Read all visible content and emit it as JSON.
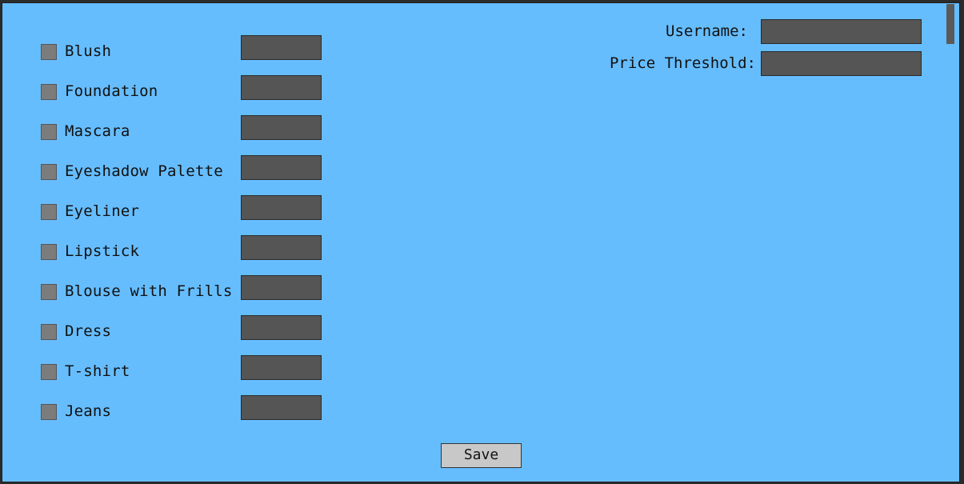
{
  "colors": {
    "background": "#66bdfe",
    "input_fill": "#555555",
    "checkbox_fill": "#7c7c7c",
    "button_fill": "#c8c8c8"
  },
  "items": [
    {
      "label": "Blush",
      "checked": false,
      "value": ""
    },
    {
      "label": "Foundation",
      "checked": false,
      "value": ""
    },
    {
      "label": "Mascara",
      "checked": false,
      "value": ""
    },
    {
      "label": "Eyeshadow Palette",
      "checked": false,
      "value": ""
    },
    {
      "label": "Eyeliner",
      "checked": false,
      "value": ""
    },
    {
      "label": "Lipstick",
      "checked": false,
      "value": ""
    },
    {
      "label": "Blouse with Frills",
      "checked": false,
      "value": ""
    },
    {
      "label": "Dress",
      "checked": false,
      "value": ""
    },
    {
      "label": "T-shirt",
      "checked": false,
      "value": ""
    },
    {
      "label": "Jeans",
      "checked": false,
      "value": ""
    }
  ],
  "settings": {
    "username_label": "Username:",
    "username_value": "",
    "price_threshold_label": "Price Threshold:",
    "price_threshold_value": ""
  },
  "save_label": "Save"
}
